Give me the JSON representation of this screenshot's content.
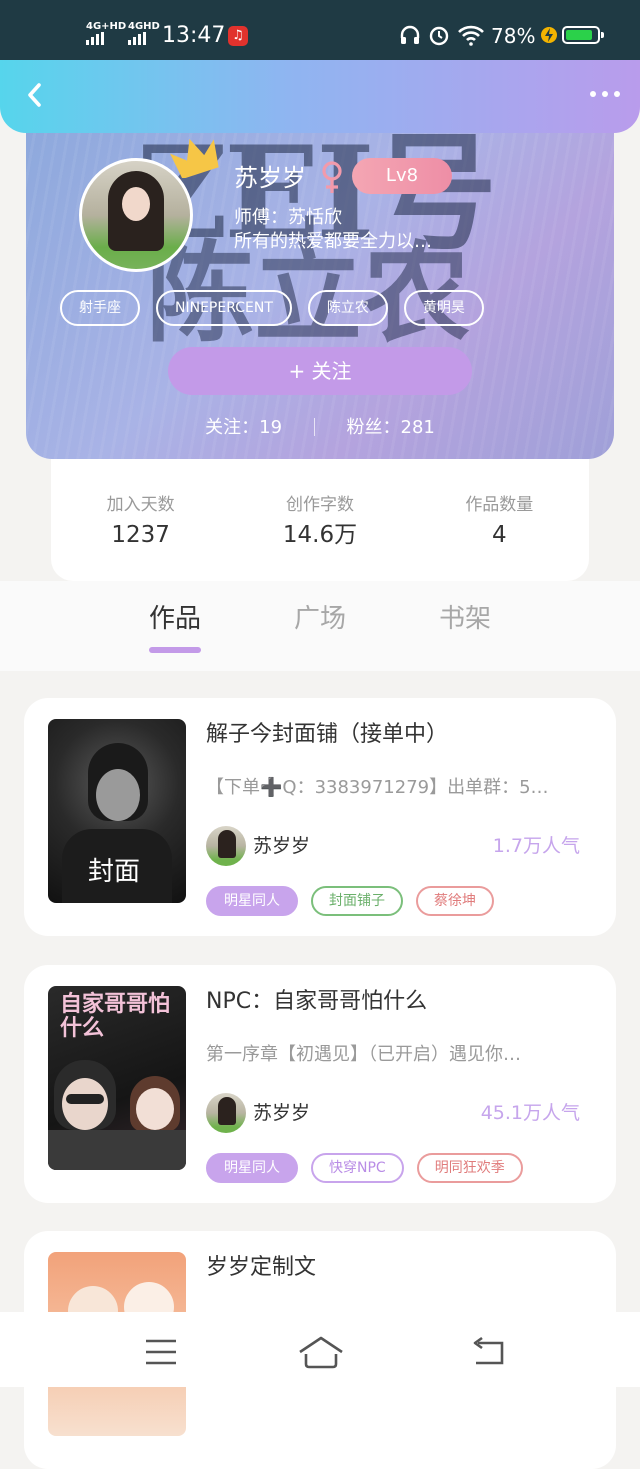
{
  "status_bar": {
    "network1": "4G+HD",
    "network2": "4GHD",
    "time": "13:47",
    "battery_percent": "78%"
  },
  "header": {
    "back_icon": "chevron-left-icon",
    "more_icon": "more-dots-icon"
  },
  "profile": {
    "nickname": "苏岁岁",
    "gender_icon": "female-icon",
    "level": "Lv8",
    "master": "师傅：苏恬欣",
    "bio": "所有的热爱都要全力以…",
    "banner_text_1": "ZEI号",
    "banner_text_2": "陈立农",
    "tags": [
      "射手座",
      "NINEPERCENT",
      "陈立农",
      "黄明昊"
    ],
    "follow_button": "+ 关注",
    "following": "关注：19",
    "fans": "粉丝：281"
  },
  "stats": [
    {
      "label": "加入天数",
      "value": "1237"
    },
    {
      "label": "创作字数",
      "value": "14.6万"
    },
    {
      "label": "作品数量",
      "value": "4"
    }
  ],
  "tabs": [
    {
      "label": "作品",
      "active": true
    },
    {
      "label": "广场",
      "active": false
    },
    {
      "label": "书架",
      "active": false
    }
  ],
  "works": [
    {
      "title": "解子今封面铺（接单中）",
      "desc": "【下单➕Q：3383971279】出单群：5…",
      "author": "苏岁岁",
      "popularity": "1.7万人气",
      "cover_text": "封面",
      "tags": [
        {
          "label": "明星同人",
          "style": "fill"
        },
        {
          "label": "封面铺子",
          "style": "green"
        },
        {
          "label": "蔡徐坤",
          "style": "red"
        }
      ]
    },
    {
      "title": "NPC：自家哥哥怕什么",
      "desc": "第一序章【初遇见】（已开启）遇见你…",
      "author": "苏岁岁",
      "popularity": "45.1万人气",
      "cover_text": "自家哥哥怕什么",
      "tags": [
        {
          "label": "明星同人",
          "style": "fill"
        },
        {
          "label": "快穿NPC",
          "style": "purple"
        },
        {
          "label": "明同狂欢季",
          "style": "red"
        }
      ]
    },
    {
      "title": "岁岁定制文",
      "desc": "",
      "author": "",
      "popularity": "",
      "cover_text": "",
      "tags": []
    }
  ],
  "bottom_nav": {
    "menu_icon": "menu-icon",
    "home_icon": "home-icon",
    "back_icon": "back-arrow-icon"
  },
  "colors": {
    "accent_purple": "#c39ae8",
    "header_start": "#56d5ec",
    "header_end": "#b99cec",
    "level_badge": "#ee8ea6"
  }
}
